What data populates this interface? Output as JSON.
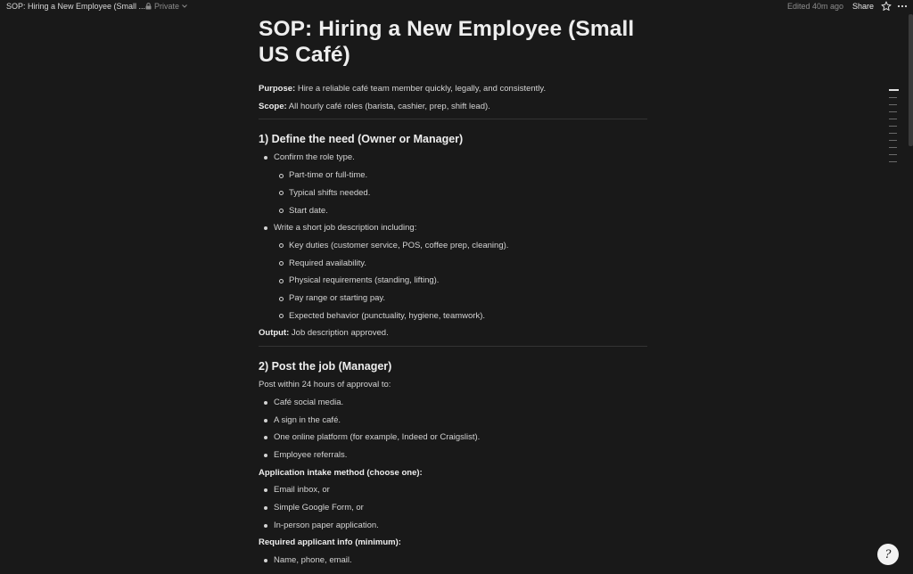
{
  "topbar": {
    "breadcrumb_title": "SOP: Hiring a New Employee (Small ...",
    "privacy_label": "Private",
    "edited_label": "Edited 40m ago",
    "share_label": "Share"
  },
  "page": {
    "title": "SOP: Hiring a New Employee (Small US Café)",
    "purpose_label": "Purpose:",
    "purpose_text": " Hire a reliable café team member quickly, legally, and consistently.",
    "scope_label": "Scope:",
    "scope_text": " All hourly café roles (barista, cashier, prep, shift lead).",
    "section1": {
      "heading": "1) Define the need (Owner or Manager)",
      "items": [
        {
          "level": 1,
          "text": "Confirm the role type."
        },
        {
          "level": 2,
          "text": "Part-time or full-time."
        },
        {
          "level": 2,
          "text": "Typical shifts needed."
        },
        {
          "level": 2,
          "text": "Start date."
        },
        {
          "level": 1,
          "text": "Write a short job description including:"
        },
        {
          "level": 2,
          "text": "Key duties (customer service, POS, coffee prep, cleaning)."
        },
        {
          "level": 2,
          "text": "Required availability."
        },
        {
          "level": 2,
          "text": "Physical requirements (standing, lifting)."
        },
        {
          "level": 2,
          "text": "Pay range or starting pay."
        },
        {
          "level": 2,
          "text": "Expected behavior (punctuality, hygiene, teamwork)."
        }
      ],
      "output_label": "Output:",
      "output_text": " Job description approved."
    },
    "section2": {
      "heading": "2) Post the job (Manager)",
      "intro": "Post within 24 hours of approval to:",
      "post_items": [
        "Café social media.",
        "A sign in the café.",
        "One online platform (for example, Indeed or Craigslist).",
        "Employee referrals."
      ],
      "intake_label": "Application intake method (choose one):",
      "intake_items": [
        "Email inbox, or",
        "Simple Google Form, or",
        "In-person paper application."
      ],
      "required_label": "Required applicant info (minimum):",
      "required_items": [
        "Name, phone, email."
      ]
    }
  },
  "icons": {
    "lock": "lock-icon",
    "chevron": "chevron-down-icon",
    "star": "star-icon",
    "more": "more-horizontal-icon",
    "help": "help-icon"
  }
}
